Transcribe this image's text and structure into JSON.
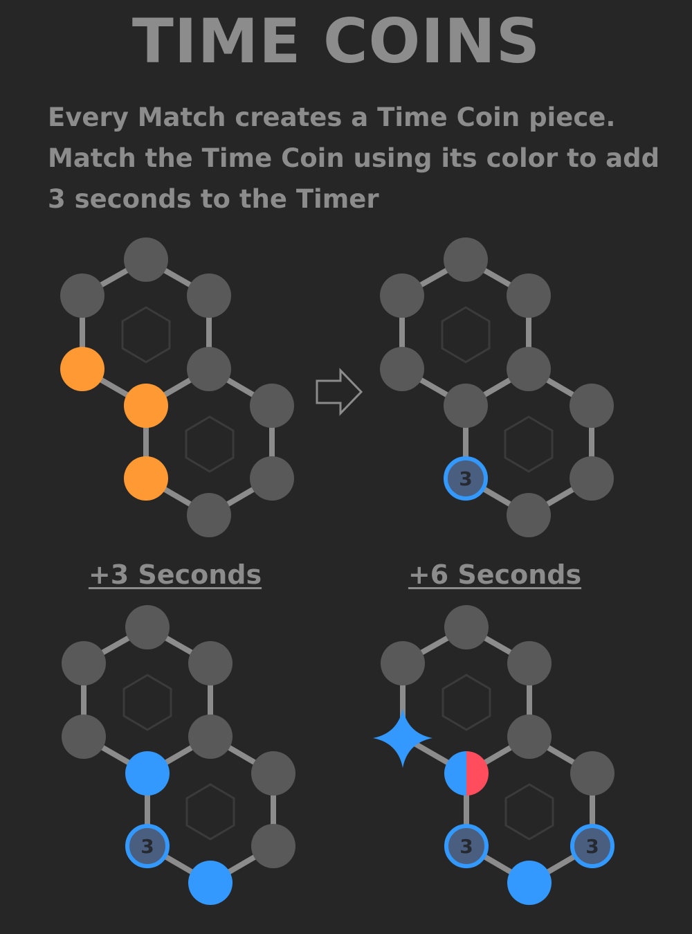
{
  "title": "TIME COINS",
  "description": [
    "Every Match creates a Time Coin piece.",
    "Match the Time Coin using its color to add",
    "3 seconds to the Timer"
  ],
  "captions": {
    "left": "+3 Seconds",
    "right": "+6 Seconds"
  },
  "time_coin_value": "3",
  "colors": {
    "background": "#262626",
    "text": "#8c8c8c",
    "node": "#595959",
    "edge": "#8c8c8c",
    "orange": "#ff9933",
    "blue": "#3399ff",
    "red": "#ff4d5e",
    "coin_fill": "#4a5f80"
  },
  "icons": {
    "arrow": "right-arrow-outline-icon",
    "special": "four-point-star-icon"
  }
}
